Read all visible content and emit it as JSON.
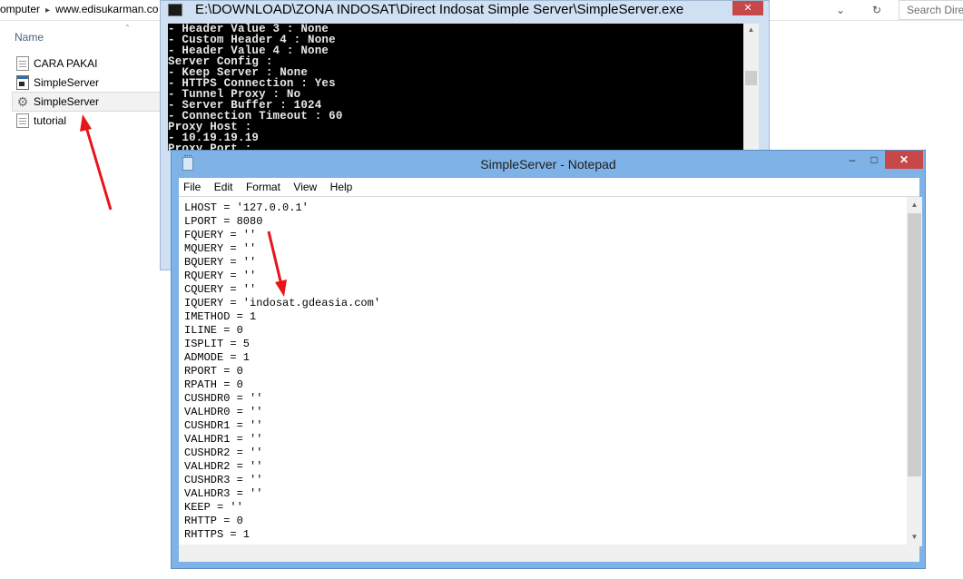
{
  "explorer": {
    "address_path": [
      "omputer",
      "www.edisukarman.co"
    ],
    "search_placeholder": "Search Direc",
    "column_header": "Name",
    "files": [
      {
        "name": "CARA PAKAI",
        "icon": "text-document-icon"
      },
      {
        "name": "SimpleServer",
        "icon": "application-icon"
      },
      {
        "name": "SimpleServer",
        "icon": "config-settings-icon"
      },
      {
        "name": "tutorial",
        "icon": "text-document-icon"
      }
    ]
  },
  "console": {
    "title": "E:\\DOWNLOAD\\ZONA INDOSAT\\Direct Indosat Simple Server\\SimpleServer.exe",
    "close_label": "✕",
    "lines": [
      "- Header Value 3 : None",
      "- Custom Header 4 : None",
      "- Header Value 4 : None",
      "Server Config :",
      "- Keep Server : None",
      "- HTTPS Connection : Yes",
      "- Tunnel Proxy : No",
      "- Server Buffer : 1024",
      "- Connection Timeout : 60",
      "Proxy Host :",
      "- 10.19.19.19",
      "Proxy Port :"
    ]
  },
  "notepad": {
    "title": "SimpleServer - Notepad",
    "min_label": "–",
    "max_label": "□",
    "close_label": "✕",
    "menu": [
      "File",
      "Edit",
      "Format",
      "View",
      "Help"
    ],
    "lines": [
      "LHOST = '127.0.0.1'",
      "LPORT = 8080",
      "FQUERY = ''",
      "MQUERY = ''",
      "BQUERY = ''",
      "RQUERY = ''",
      "CQUERY = ''",
      "IQUERY = 'indosat.gdeasia.com'",
      "IMETHOD = 1",
      "ILINE = 0",
      "ISPLIT = 5",
      "ADMODE = 1",
      "RPORT = 0",
      "RPATH = 0",
      "CUSHDR0 = ''",
      "VALHDR0 = ''",
      "CUSHDR1 = ''",
      "VALHDR1 = ''",
      "CUSHDR2 = ''",
      "VALHDR2 = ''",
      "CUSHDR3 = ''",
      "VALHDR3 = ''",
      "KEEP = ''",
      "RHTTP = 0",
      "RHTTPS = 1"
    ]
  },
  "colors": {
    "notepad_frame": "#7fb2e6",
    "console_frame": "#cfe0f3",
    "close_button": "#c74848",
    "annotation_arrow": "#e8141c"
  }
}
